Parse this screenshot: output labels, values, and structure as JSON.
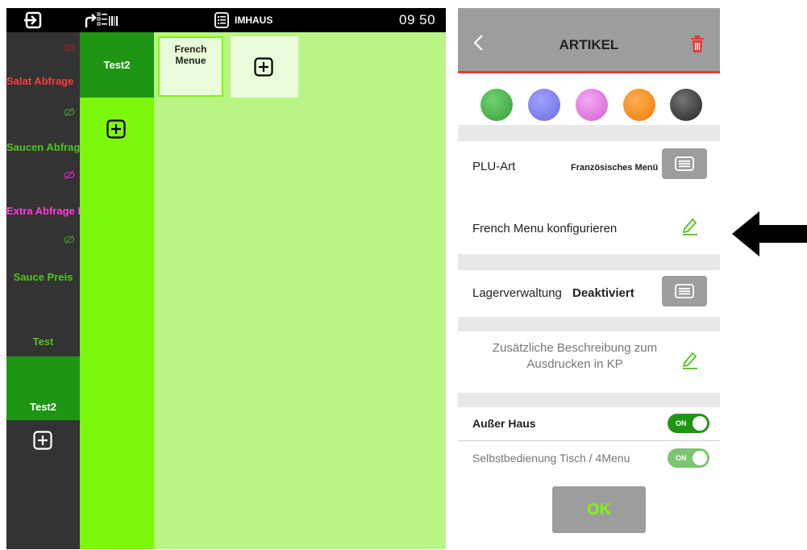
{
  "topbar": {
    "title": "IMHAUS",
    "time": "09 50"
  },
  "categories": [
    {
      "label": "Salat Abfrage",
      "color": "#ff3b3b",
      "eye_color": "#8b2323"
    },
    {
      "label": "Saucen Abfrage",
      "color": "#53c41c",
      "eye_color": "#4a8a2a"
    },
    {
      "label": "Extra Abfrage Kl",
      "color": "#ff3bd8",
      "eye_color": "#c22bb0"
    },
    {
      "label": "Sauce Preis",
      "color": "#53c41c",
      "eye_color": "#4a8a2a"
    },
    {
      "label": "Test",
      "color": "#53c41c"
    },
    {
      "label": "Test2",
      "color": "#ffffff",
      "selected": true
    }
  ],
  "subcategories": [
    {
      "label": "Test2"
    }
  ],
  "menu_tiles": [
    {
      "label": "French\nMenue"
    }
  ],
  "panel": {
    "title": "ARTIKEL",
    "colors": [
      "#4caf50",
      "#8080ee",
      "#e070e0",
      "#ff8c1a",
      "#333333"
    ],
    "plu_label": "PLU-Art",
    "plu_value": "Französisches Menü",
    "french_menu_label": "French Menu konfigurieren",
    "lager_label": "Lagerverwaltung",
    "lager_value": "Deaktiviert",
    "desc_label": "Zusätzliche Beschreibung zum\nAusdrucken in KP",
    "ausser_haus_label": "Außer Haus",
    "selbst_label": "Selbstbedienung Tisch / 4Menu",
    "toggle_on": "ON",
    "ok_label": "OK"
  }
}
